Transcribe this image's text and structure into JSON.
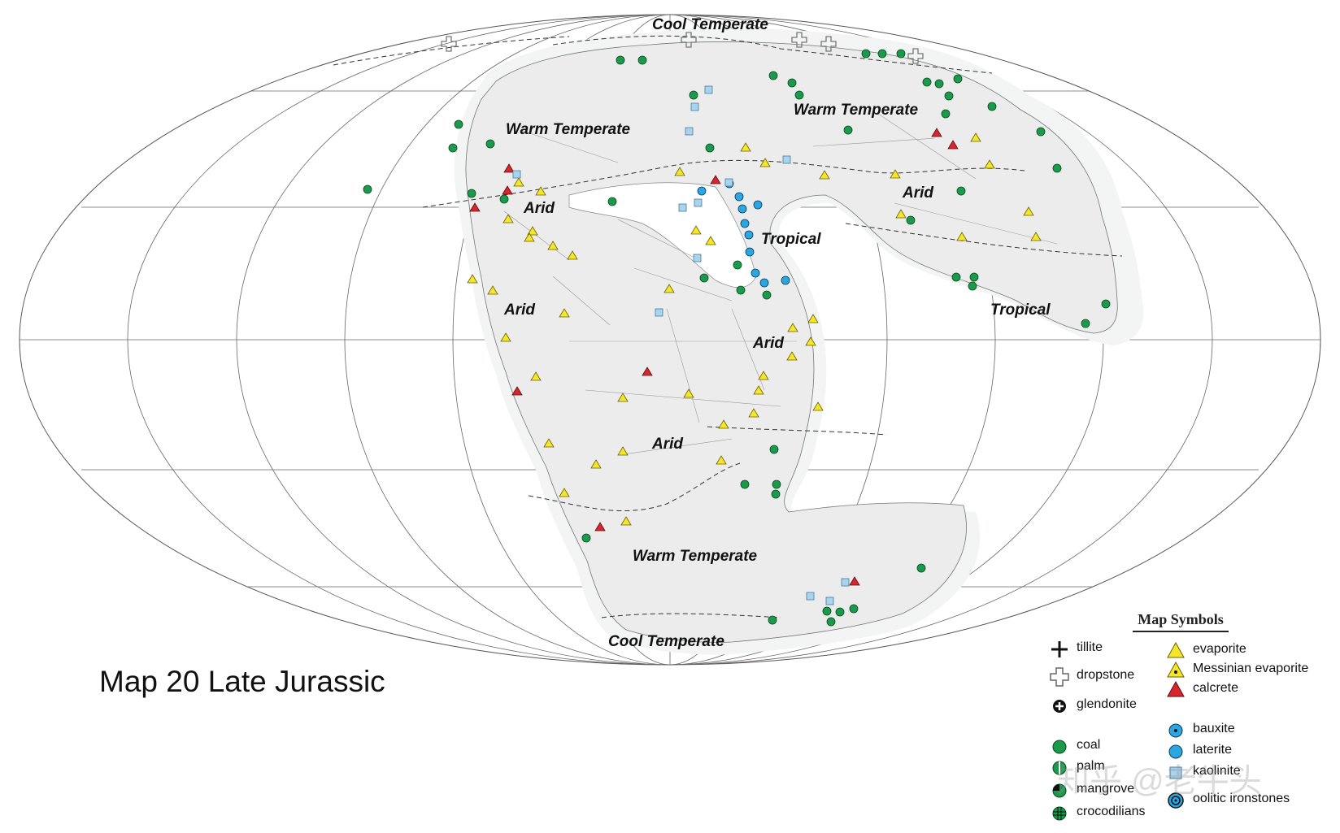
{
  "title": "Map 20  Late Jurassic",
  "climate_zones": [
    {
      "id": "cool-temperate-n",
      "label": "Cool Temperate"
    },
    {
      "id": "warm-temperate-nw",
      "label": "Warm Temperate"
    },
    {
      "id": "warm-temperate-ne",
      "label": "Warm Temperate"
    },
    {
      "id": "arid-nw",
      "label": "Arid"
    },
    {
      "id": "arid-ne",
      "label": "Arid"
    },
    {
      "id": "tropical-c",
      "label": "Tropical"
    },
    {
      "id": "tropical-e",
      "label": "Tropical"
    },
    {
      "id": "arid-w",
      "label": "Arid"
    },
    {
      "id": "arid-c",
      "label": "Arid"
    },
    {
      "id": "arid-s",
      "label": "Arid"
    },
    {
      "id": "warm-temperate-s",
      "label": "Warm Temperate"
    },
    {
      "id": "cool-temperate-s",
      "label": "Cool Temperate"
    }
  ],
  "legend": {
    "title": "Map Symbols",
    "items": [
      {
        "id": "tillite",
        "label": "tillite"
      },
      {
        "id": "dropstone",
        "label": "dropstone"
      },
      {
        "id": "glendonite",
        "label": "glendonite"
      },
      {
        "id": "coal",
        "label": "coal"
      },
      {
        "id": "palm",
        "label": "palm"
      },
      {
        "id": "mangrove",
        "label": "mangrove"
      },
      {
        "id": "crocodilians",
        "label": "crocodilians"
      },
      {
        "id": "evaporite",
        "label": "evaporite"
      },
      {
        "id": "messinian-evaporite",
        "label": "Messinian evaporite"
      },
      {
        "id": "calcrete",
        "label": "calcrete"
      },
      {
        "id": "bauxite",
        "label": "bauxite"
      },
      {
        "id": "laterite",
        "label": "laterite"
      },
      {
        "id": "kaolinite",
        "label": "kaolinite"
      },
      {
        "id": "oolitic-ironstones",
        "label": "oolitic ironstones"
      }
    ]
  },
  "colors": {
    "coal": "#1a9a4a",
    "evaporite": "#f5e62a",
    "calcrete": "#d8262e",
    "bauxite": "#2aa7e0",
    "kaolinite": "#a9d4ef",
    "land": "#ececec",
    "shelf": "#f3f4f4"
  },
  "watermark": "知乎 @老牛头"
}
